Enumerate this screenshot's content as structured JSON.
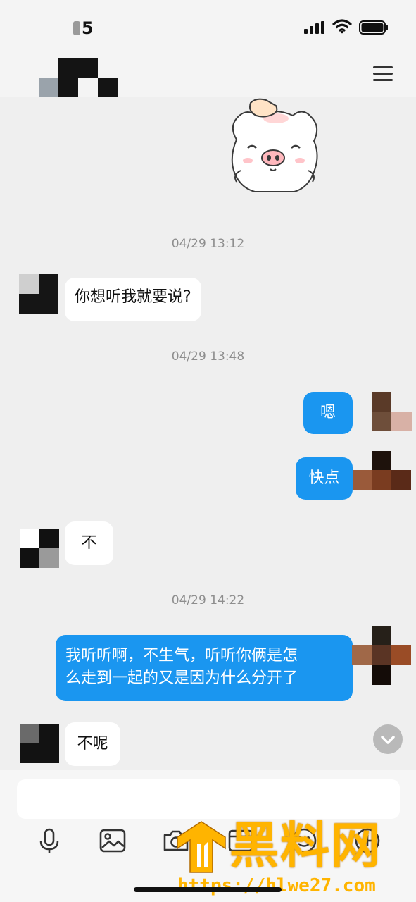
{
  "status_bar": {
    "time": "5"
  },
  "header": {
    "menu_icon": "hamburger-menu-icon"
  },
  "colors": {
    "outgoing_bubble": "#1a96f0",
    "incoming_bubble": "#ffffff",
    "background": "#efefef",
    "timestamp_text": "#8e8e8e",
    "watermark": "#ffb400"
  },
  "messages": {
    "ts1": "04/29 13:12",
    "m1": "你想听我就要说?",
    "ts2": "04/29 13:48",
    "m2": "嗯",
    "m3": "快点",
    "m4": "不",
    "ts3": "04/29 14:22",
    "m5_line1": "我听听啊，不生气，听听你俩是怎",
    "m5_line2": "么走到一起的又是因为什么分开了",
    "m6": "不呢"
  },
  "toolbar": {
    "icons": [
      "microphone-icon",
      "image-icon",
      "camera-icon",
      "folder-icon",
      "emoji-icon",
      "plus-icon"
    ]
  },
  "watermark": {
    "title": "黑料网",
    "url": "https://hlwe27.com"
  }
}
